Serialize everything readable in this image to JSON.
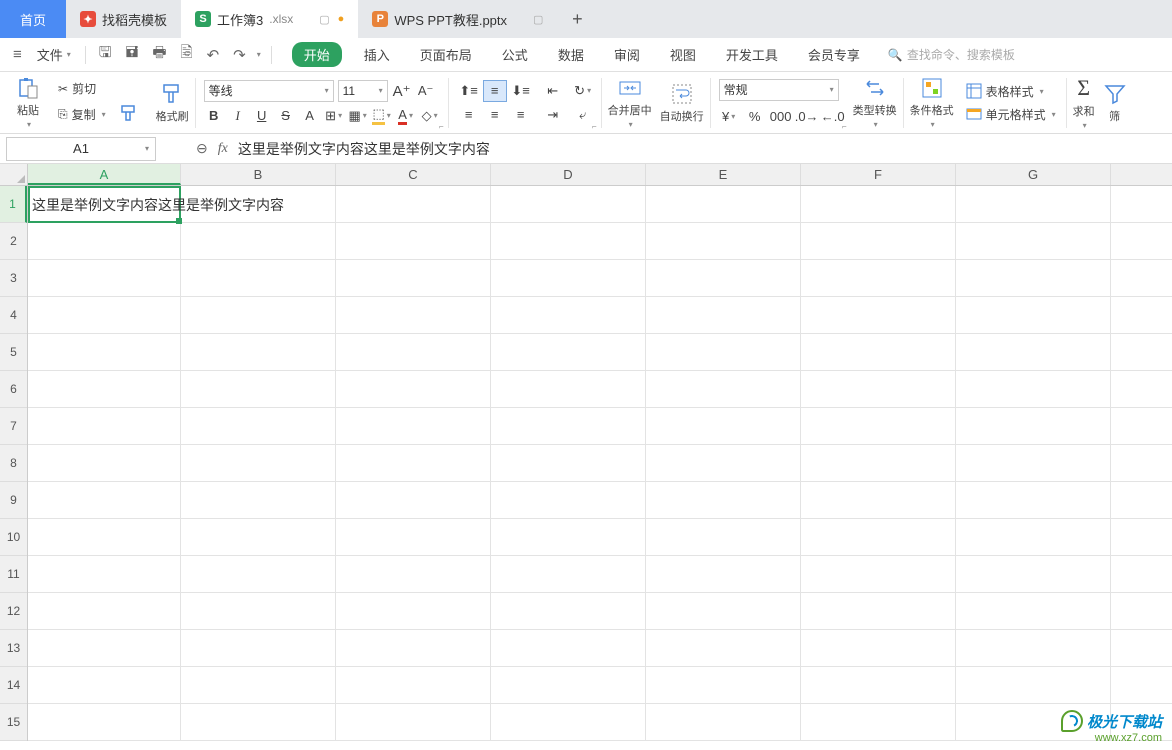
{
  "tabs": {
    "home": "首页",
    "t1": "找稻壳模板",
    "t2_name": "工作簿3",
    "t2_ext": ".xlsx",
    "t3": "WPS PPT教程.pptx"
  },
  "menu": {
    "file": "文件"
  },
  "ribbon": {
    "start": "开始",
    "insert": "插入",
    "layout": "页面布局",
    "formula": "公式",
    "data": "数据",
    "review": "审阅",
    "view": "视图",
    "dev": "开发工具",
    "vip": "会员专享"
  },
  "search": {
    "placeholder": "查找命令、搜索模板"
  },
  "toolbar": {
    "paste": "粘贴",
    "cut": "剪切",
    "copy": "复制",
    "format_painter": "格式刷",
    "font_name": "等线",
    "font_size": "11",
    "merge": "合并居中",
    "wrap": "自动换行",
    "number_format": "常规",
    "type_convert": "类型转换",
    "cond_format": "条件格式",
    "table_style": "表格样式",
    "cell_style": "单元格样式",
    "sum": "求和",
    "filter": "筛"
  },
  "formula_bar": {
    "name_box": "A1",
    "fx": "fx",
    "content": "这里是举例文字内容这里是举例文字内容"
  },
  "grid": {
    "columns": [
      "A",
      "B",
      "C",
      "D",
      "E",
      "F",
      "G"
    ],
    "rows": [
      "1",
      "2",
      "3",
      "4",
      "5",
      "6",
      "7",
      "8",
      "9",
      "10",
      "11",
      "12",
      "13",
      "14",
      "15"
    ],
    "a1_text": "这里是举例文字内容这里是举例文字内容"
  },
  "watermark": {
    "line1": "极光下载站",
    "line2": "www.xz7.com"
  }
}
